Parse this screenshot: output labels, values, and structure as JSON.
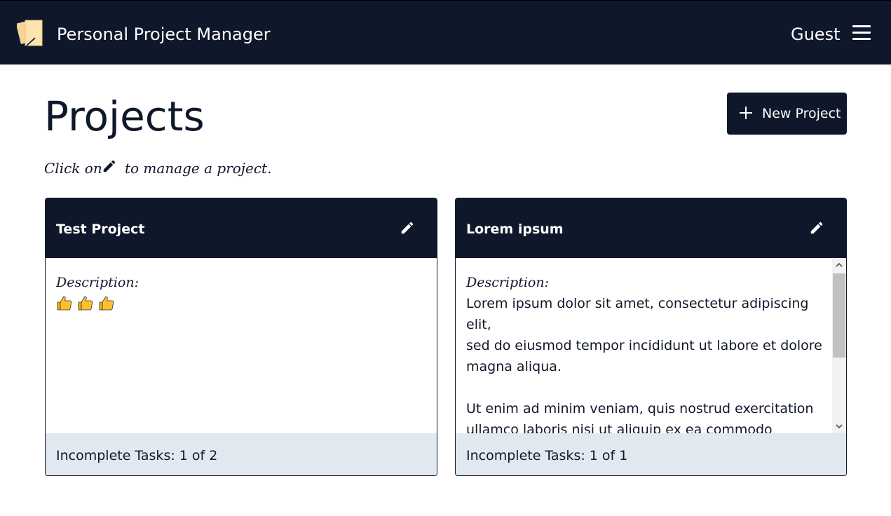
{
  "app": {
    "title": "Personal Project Manager"
  },
  "header": {
    "user_label": "Guest"
  },
  "page": {
    "title": "Projects",
    "new_project_label": "New Project",
    "hint_prefix": "Click on",
    "hint_suffix": "to manage a project."
  },
  "projects": [
    {
      "title": "Test Project",
      "description_label": "Description:",
      "description_emoji": [
        "thumbs-up",
        "thumbs-up",
        "thumbs-up"
      ],
      "footer": "Incomplete Tasks: 1 of 2"
    },
    {
      "title": "Lorem ipsum",
      "description_label": "Description:",
      "description": "Lorem ipsum dolor sit amet, consectetur adipiscing elit,\nsed do eiusmod tempor incididunt ut labore et dolore\nmagna aliqua.\n\nUt enim ad minim veniam, quis nostrud exercitation\nullamco laboris nisi ut aliquip ex ea commodo consequat.\nDuis aute irure dolor in reprehenderit in voluptate velit",
      "footer": "Incomplete Tasks: 1 of 1"
    }
  ],
  "colors": {
    "navy": "#0f172a",
    "footer_bg": "#e2e8f0",
    "logo_paper": "#fde3b0"
  },
  "icons": {
    "logo": "notepad-icon",
    "menu": "hamburger-menu-icon",
    "add": "plus-icon",
    "edit": "pencil-icon"
  }
}
